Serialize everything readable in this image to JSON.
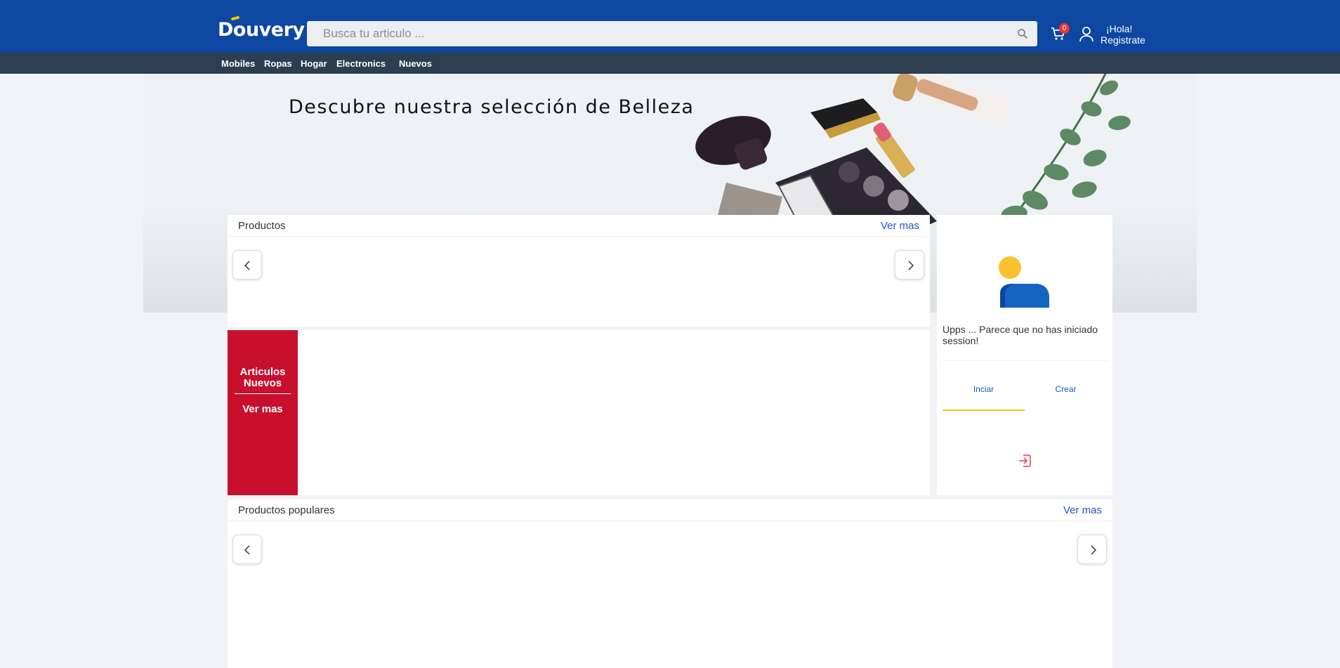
{
  "header": {
    "logo_text": "Douvery",
    "search_placeholder": "Busca tu articulo ...",
    "cart_count": "0",
    "greeting_line1": "¡Hola!",
    "greeting_line2": "Registrate",
    "colors": {
      "bar": "#0d47a1",
      "accent": "#ffc107",
      "badge": "#e53935"
    }
  },
  "nav": {
    "items": [
      {
        "label": "Mobiles"
      },
      {
        "label": "Ropas"
      },
      {
        "label": "Hogar"
      },
      {
        "label": "Electronics"
      },
      {
        "label": "Nuevos"
      }
    ]
  },
  "banner": {
    "title": "Descubre nuestra selección de Belleza"
  },
  "products": {
    "title": "Productos",
    "more_label": "Ver mas"
  },
  "new_items": {
    "title": "Articulos Nuevos",
    "more_label": "Ver mas",
    "color": "#c8102e"
  },
  "popular": {
    "title": "Productos populares",
    "more_label": "Ver mas"
  },
  "login_card": {
    "message": "Upps ... Parece que no has iniciado session!",
    "tabs": [
      {
        "label": "Inciar"
      },
      {
        "label": "Crear"
      }
    ]
  }
}
